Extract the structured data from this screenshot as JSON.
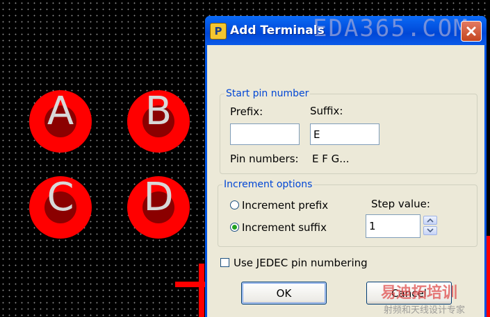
{
  "canvas": {
    "pads": [
      {
        "label": "A"
      },
      {
        "label": "B"
      },
      {
        "label": "C"
      },
      {
        "label": "D"
      }
    ]
  },
  "dialog": {
    "title": "Add Terminals",
    "watermark": "EDA365.COM",
    "start_pin": {
      "legend": "Start pin number",
      "prefix_label": "Prefix:",
      "prefix_value": "",
      "suffix_label": "Suffix:",
      "suffix_value": "E",
      "pin_numbers_label": "Pin numbers:",
      "pin_numbers_value": "E F G..."
    },
    "increment": {
      "legend": "Increment options",
      "option_prefix": "Increment prefix",
      "option_suffix": "Increment suffix",
      "selected": "suffix",
      "step_label": "Step value:",
      "step_value": "1"
    },
    "jedec_label": "Use JEDEC pin numbering",
    "jedec_checked": false,
    "ok_label": "OK",
    "cancel_label": "Cancel"
  },
  "overlay_watermark": {
    "line1": "易迪拓培训",
    "line2": "射频和天线设计专家"
  },
  "colors": {
    "pad_outer": "#ff0000",
    "pad_inner": "#8b0000",
    "titlebar": "#0054e3",
    "dialog_bg": "#ece9d8",
    "group_legend": "#0046d5"
  }
}
